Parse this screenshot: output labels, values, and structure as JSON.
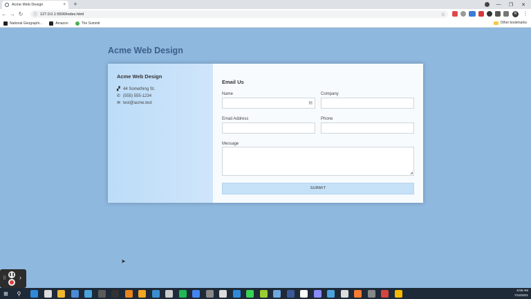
{
  "browser": {
    "tab_title": "Acme Web Design",
    "tab_close": "×",
    "new_tab": "+",
    "url": "127.0.0.1:5500/index.html",
    "bookmarks": [
      {
        "label": "National Geographi...",
        "color": "#222"
      },
      {
        "label": "Amazon",
        "color": "#222"
      },
      {
        "label": "The Summit",
        "color": "#4caf50"
      }
    ],
    "other_bookmarks": "Other bookmarks",
    "window_controls": [
      "—",
      "❐",
      "✕"
    ]
  },
  "page": {
    "title": "Acme Web Design",
    "contact": {
      "heading": "Acme Web Design",
      "address": "44 Something St.",
      "phone": "(555) 555-1234",
      "email": "test@acme.test"
    },
    "form": {
      "heading": "Email Us",
      "name_label": "Name",
      "company_label": "Company",
      "email_label": "Email Address",
      "phone_label": "Phone",
      "message_label": "Message",
      "submit_label": "SUBMIT"
    }
  },
  "taskbar": {
    "time": "6:55 AM",
    "date": "7/14/2021",
    "icon_colors": [
      "#2f89d8",
      "#ddd",
      "#f1b82d",
      "#4a8dd6",
      "#4aa3df",
      "#5b5b5b",
      "#333",
      "#e8861a",
      "#f5a623",
      "#3c8dd0",
      "#ccc",
      "#1db954",
      "#4285f4",
      "#888",
      "#ddd",
      "#2f89d8",
      "#39d353",
      "#9acd32",
      "#6fa8dc",
      "#3b5998",
      "#fff",
      "#8a8aff",
      "#4aa3df",
      "#ddd",
      "#f97a32",
      "#888",
      "#d4453f",
      "#f5b800"
    ]
  },
  "colors": {
    "background": "#8fb8df",
    "title": "#3a5f8a",
    "sidebar": "#bcdcf8",
    "submit": "#c5e1f8"
  }
}
